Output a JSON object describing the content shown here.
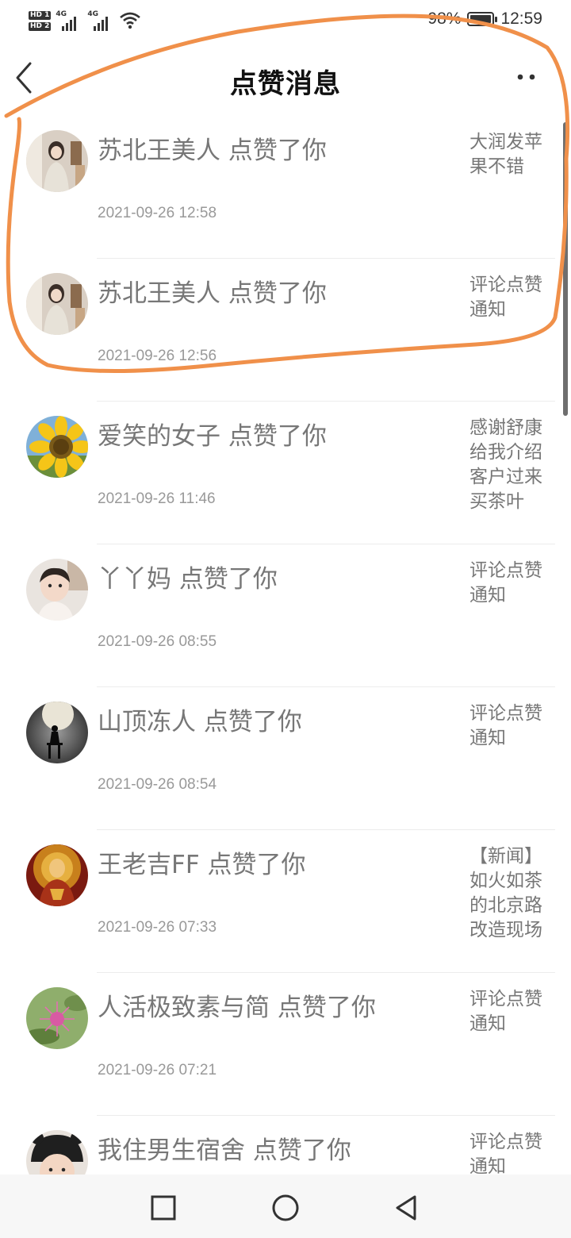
{
  "status": {
    "hd1": "HD 1",
    "hd2": "HD 2",
    "net1": "4G",
    "net2": "4G",
    "battery_percent": 98,
    "battery_text": "98%",
    "time": "12:59"
  },
  "header": {
    "title": "点赞消息",
    "back_icon": "chevron-left-icon",
    "more_icon": "more-dots-icon"
  },
  "items": [
    {
      "text": "苏北王美人 点赞了你",
      "time": "2021-09-26 12:58",
      "snippet": "大润发苹果不错",
      "avatar": "woman-photo"
    },
    {
      "text": "苏北王美人 点赞了你",
      "time": "2021-09-26 12:56",
      "snippet": "评论点赞通知",
      "avatar": "woman-photo"
    },
    {
      "text": "爱笑的女子 点赞了你",
      "time": "2021-09-26 11:46",
      "snippet": "感谢舒康给我介绍客户过来买茶叶",
      "avatar": "sunflower"
    },
    {
      "text": "丫丫妈 点赞了你",
      "time": "2021-09-26 08:55",
      "snippet": "评论点赞通知",
      "avatar": "child-photo"
    },
    {
      "text": "山顶冻人 点赞了你",
      "time": "2021-09-26 08:54",
      "snippet": "评论点赞通知",
      "avatar": "moon-silhouette"
    },
    {
      "text": "王老吉FF 点赞了你",
      "time": "2021-09-26 07:33",
      "snippet": "【新闻】如火如茶的北京路改造现场",
      "avatar": "buddha-statue"
    },
    {
      "text": "人活极致素与简 点赞了你",
      "time": "2021-09-26 07:21",
      "snippet": "评论点赞通知",
      "avatar": "pink-flower"
    },
    {
      "text": "我住男生宿舍 点赞了你",
      "time": "",
      "snippet": "评论点赞通知",
      "avatar": "kid-in-hat"
    }
  ],
  "navbar": {
    "square_icon": "recent-apps-square-icon",
    "circle_icon": "home-circle-icon",
    "triangle_icon": "back-triangle-icon"
  },
  "colors": {
    "annotation": "#F0904A",
    "text_primary": "#777777",
    "text_secondary": "#999999"
  }
}
